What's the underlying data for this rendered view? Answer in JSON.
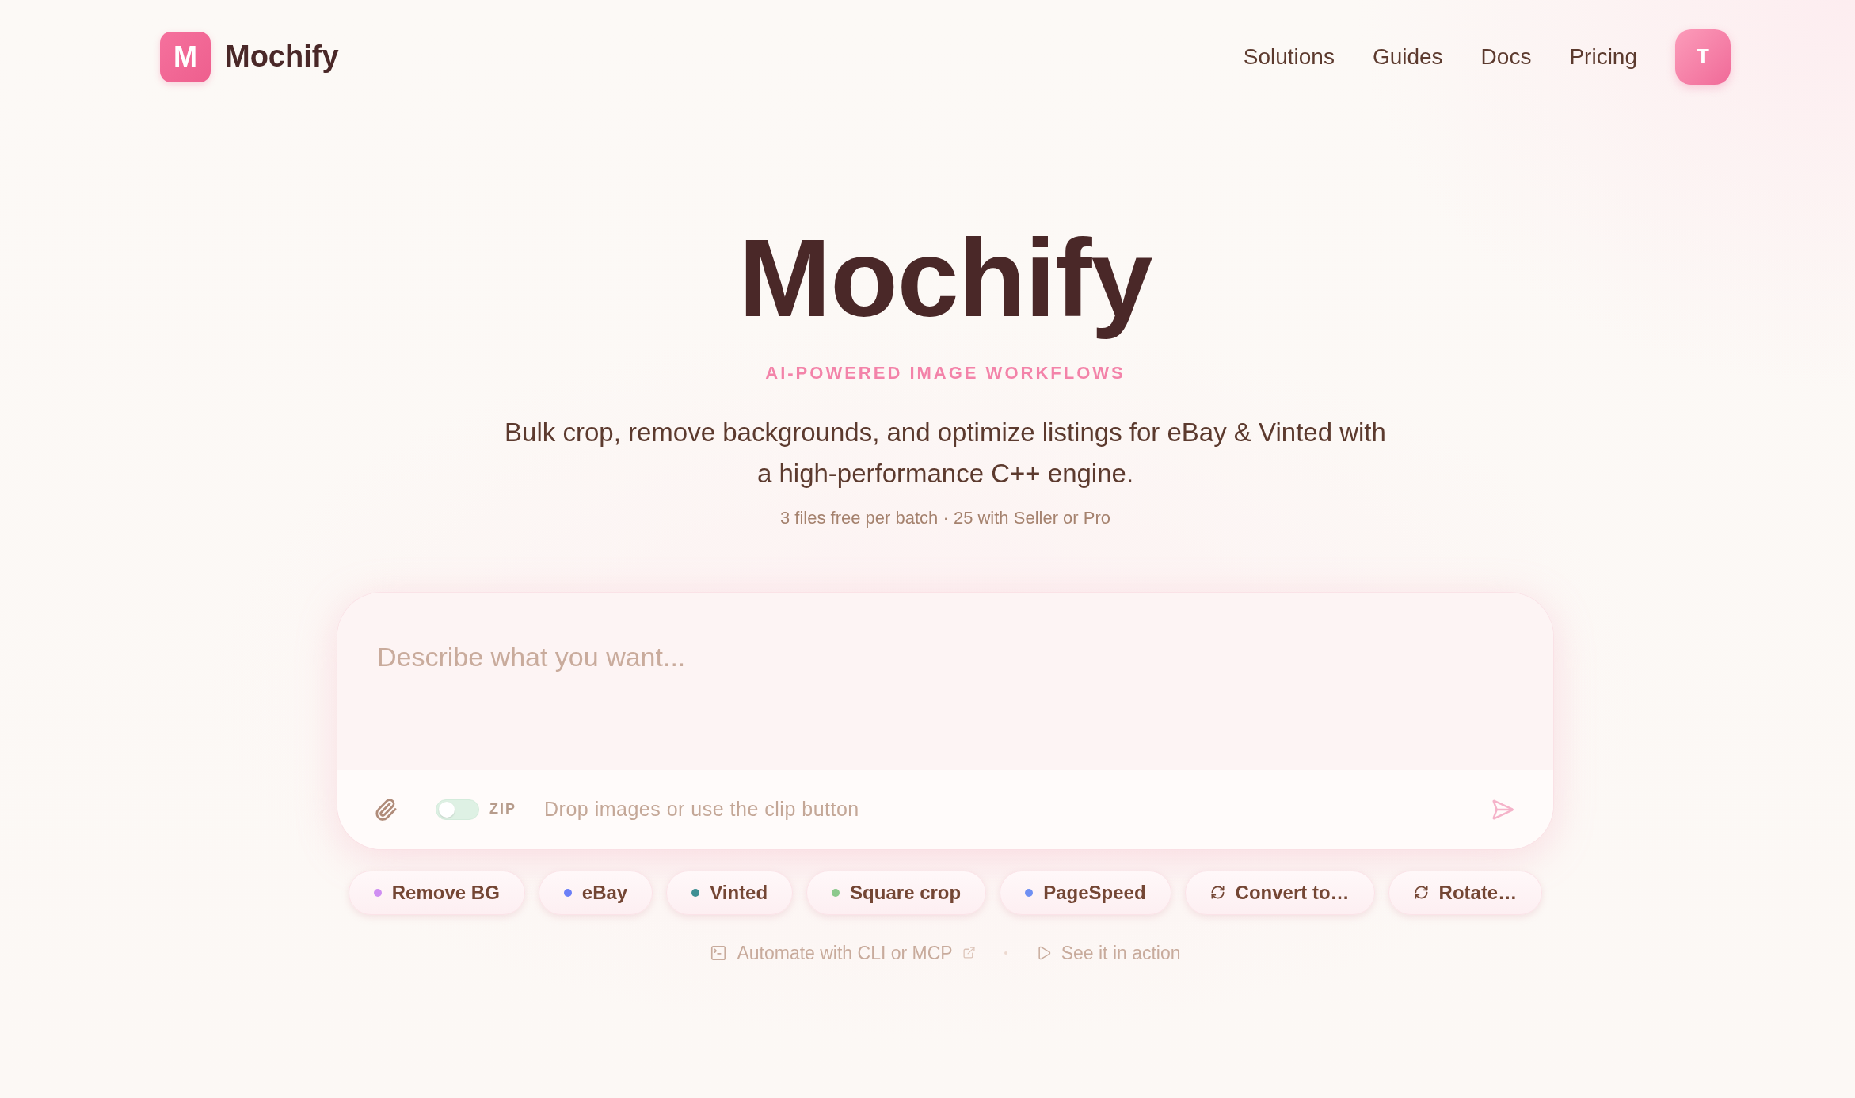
{
  "header": {
    "logo": {
      "monogram": "M",
      "name": "Mochify"
    },
    "nav": [
      "Solutions",
      "Guides",
      "Docs",
      "Pricing"
    ],
    "avatar": "T"
  },
  "hero": {
    "title": "Mochify",
    "tagline": "AI-POWERED IMAGE WORKFLOWS",
    "description": "Bulk crop, remove backgrounds, and optimize listings for eBay & Vinted with a high-performance C++ engine.",
    "note": "3 files free per batch · 25 with Seller or Pro"
  },
  "composer": {
    "placeholder": "Describe what you want...",
    "zip_toggle": {
      "label": "ZIP",
      "on": false
    },
    "hint": "Drop images or use the clip button"
  },
  "chips": [
    {
      "kind": "dot",
      "label": "Remove BG",
      "color": "#cf8ef2"
    },
    {
      "kind": "dot",
      "label": "eBay",
      "color": "#6b7ff7"
    },
    {
      "kind": "dot",
      "label": "Vinted",
      "color": "#3f8f93"
    },
    {
      "kind": "dot",
      "label": "Square crop",
      "color": "#8cc98c"
    },
    {
      "kind": "dot",
      "label": "PageSpeed",
      "color": "#6f90f3"
    },
    {
      "kind": "action",
      "label": "Convert to…"
    },
    {
      "kind": "action",
      "label": "Rotate…"
    }
  ],
  "links": [
    {
      "kind": "terminal",
      "label": "Automate with CLI or MCP",
      "external": true
    },
    {
      "kind": "play",
      "label": "See it in action",
      "external": false
    }
  ]
}
